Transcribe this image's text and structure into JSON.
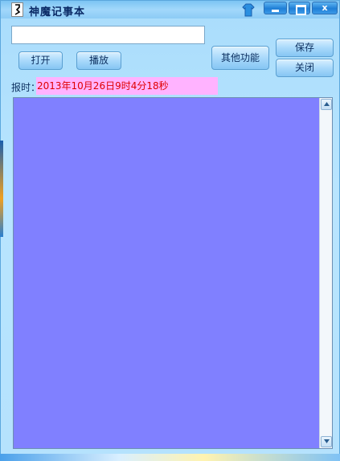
{
  "window": {
    "title": "神魔记事本",
    "icons": {
      "app": "notepad-icon",
      "skin": "skin-shirt-icon",
      "minimize": "minimize-icon",
      "maximize": "maximize-icon",
      "close": "close-icon"
    },
    "close_glyph": "x"
  },
  "toolbar": {
    "file_path_value": "",
    "open_label": "打开",
    "play_label": "播放",
    "other_label": "其他功能",
    "save_label": "保存",
    "close_label": "关闭"
  },
  "clock": {
    "label": "报时：",
    "value": "2013年10月26日9时4分18秒"
  },
  "editor": {
    "content": ""
  },
  "colors": {
    "editor_background": "#8080ff",
    "time_background": "#ffb3ff",
    "time_text": "#e00000",
    "window_background": "#b8e4ff"
  }
}
